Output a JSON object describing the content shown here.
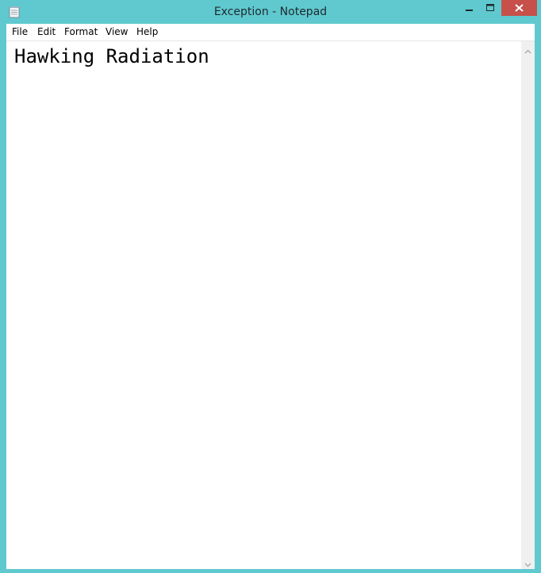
{
  "window": {
    "title": "Exception - Notepad",
    "titlebar_color": "#5fc9cf",
    "close_button_color": "#c7504a"
  },
  "icons": {
    "app": "notepad-icon",
    "minimize": "minimize-icon",
    "maximize": "maximize-icon",
    "close": "close-icon",
    "scroll_up": "chevron-up-icon",
    "scroll_down": "chevron-down-icon"
  },
  "menu": {
    "file": "File",
    "edit": "Edit",
    "format": "Format",
    "view": "View",
    "help": "Help"
  },
  "editor": {
    "content": "Hawking Radiation"
  }
}
